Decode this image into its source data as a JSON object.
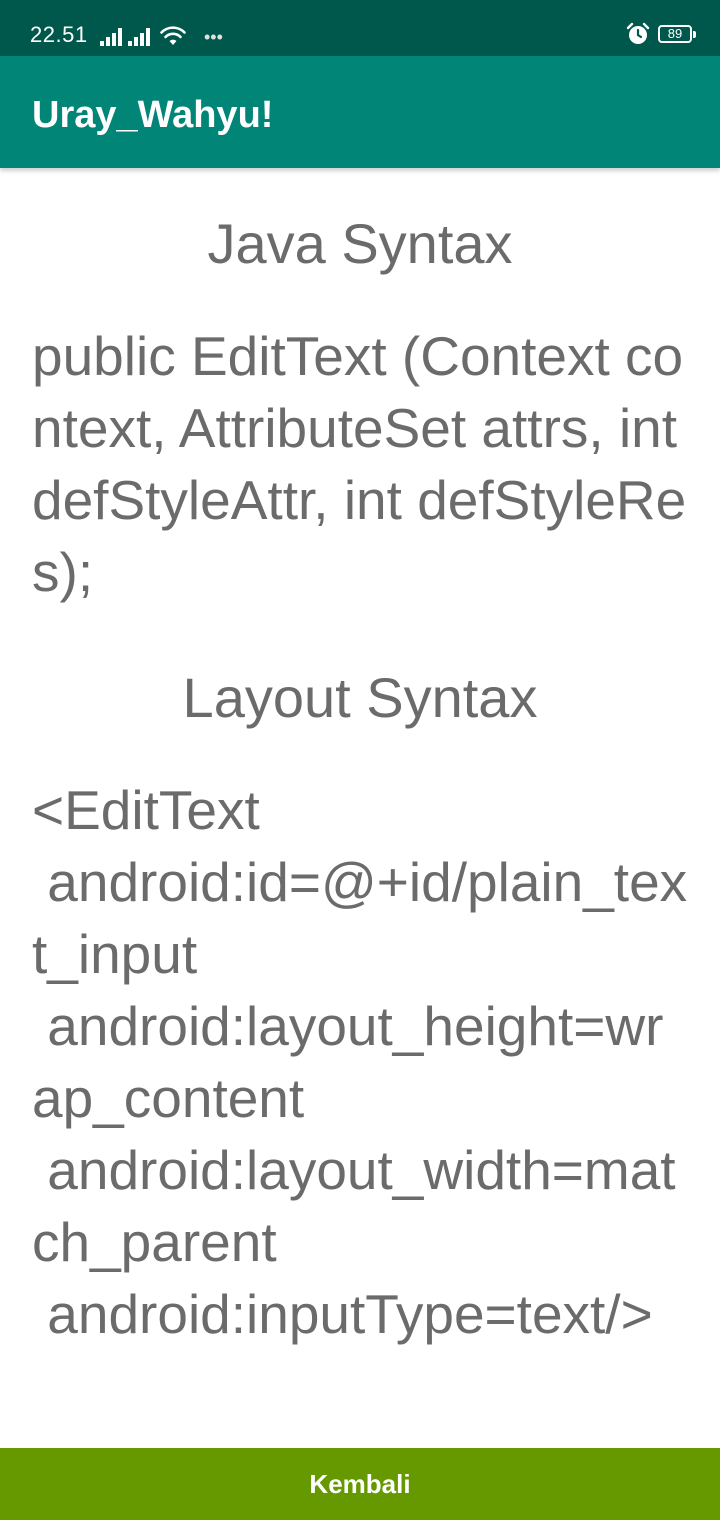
{
  "status_bar": {
    "time": "22.51",
    "battery_level": "89",
    "background_color": "#00574b"
  },
  "app_bar": {
    "title": "Uray_Wahyu!",
    "background_color": "#008577"
  },
  "content": {
    "java_section_title": "Java Syntax",
    "java_code": "public EditText (Context context, AttributeSet attrs, int defStyleAttr, int defStyleRes);",
    "layout_section_title": "Layout Syntax",
    "layout_code": "<EditText\n android:id=@+id/plain_text_input\n android:layout_height=wrap_content\n android:layout_width=match_parent\n android:inputType=text/>"
  },
  "footer": {
    "back_button_label": "Kembali",
    "button_color": "#669900"
  }
}
